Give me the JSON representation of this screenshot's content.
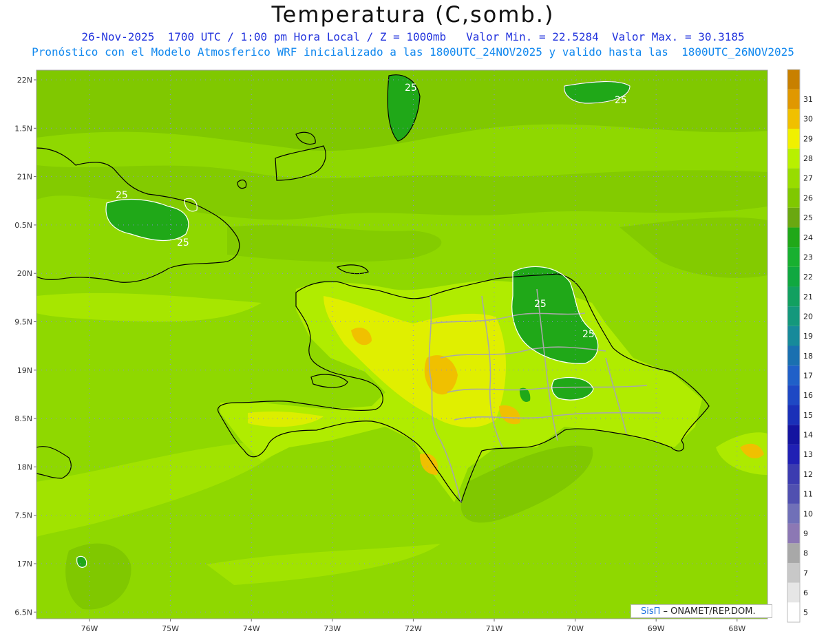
{
  "header": {
    "title": "Temperatura (C,somb.)",
    "subtitle_1": "26-Nov-2025  1700 UTC / 1:00 pm Hora Local / Z = 1000mb   Valor Min. = 22.5284  Valor Max. = 30.3185",
    "subtitle_2": "Pronóstico con el Modelo Atmosferico WRF inicializado a las 1800UTC_24NOV2025 y valido hasta las  1800UTC_26NOV2025"
  },
  "map": {
    "lat_ticks": [
      {
        "value": 22,
        "label": "22N"
      },
      {
        "value": 21.5,
        "label": "1.5N"
      },
      {
        "value": 21,
        "label": "21N"
      },
      {
        "value": 20.5,
        "label": "0.5N"
      },
      {
        "value": 20,
        "label": "20N"
      },
      {
        "value": 19.5,
        "label": "9.5N"
      },
      {
        "value": 19,
        "label": "19N"
      },
      {
        "value": 18.5,
        "label": "8.5N"
      },
      {
        "value": 18,
        "label": "18N"
      },
      {
        "value": 17.5,
        "label": "7.5N"
      },
      {
        "value": 17,
        "label": "17N"
      },
      {
        "value": 16.5,
        "label": "6.5N"
      }
    ],
    "lon_ticks": [
      {
        "value": -76,
        "label": "76W"
      },
      {
        "value": -75,
        "label": "75W"
      },
      {
        "value": -74,
        "label": "74W"
      },
      {
        "value": -73,
        "label": "73W"
      },
      {
        "value": -72,
        "label": "72W"
      },
      {
        "value": -71,
        "label": "71W"
      },
      {
        "value": -70,
        "label": "70W"
      },
      {
        "value": -69,
        "label": "69W"
      },
      {
        "value": -68,
        "label": "68W"
      }
    ],
    "contour_labels": [
      "25",
      "25",
      "25",
      "25",
      "25",
      "25"
    ],
    "background_color": "#8fd800"
  },
  "colorbar": {
    "levels": [
      {
        "label": "5",
        "color": "#ffffff"
      },
      {
        "label": "6",
        "color": "#e6e6e6"
      },
      {
        "label": "7",
        "color": "#c8c8c8"
      },
      {
        "label": "8",
        "color": "#a8a8a8"
      },
      {
        "label": "9",
        "color": "#8c78b4"
      },
      {
        "label": "10",
        "color": "#7070b8"
      },
      {
        "label": "11",
        "color": "#5050b0"
      },
      {
        "label": "12",
        "color": "#3c3cb0"
      },
      {
        "label": "13",
        "color": "#2020b4"
      },
      {
        "label": "14",
        "color": "#1414a0"
      },
      {
        "label": "15",
        "color": "#1a30b8"
      },
      {
        "label": "16",
        "color": "#1e48c4"
      },
      {
        "label": "17",
        "color": "#2060c8"
      },
      {
        "label": "18",
        "color": "#1a70b0"
      },
      {
        "label": "19",
        "color": "#178a9a"
      },
      {
        "label": "20",
        "color": "#14987c"
      },
      {
        "label": "21",
        "color": "#12a060"
      },
      {
        "label": "22",
        "color": "#10a840"
      },
      {
        "label": "23",
        "color": "#18b030"
      },
      {
        "label": "24",
        "color": "#20a818"
      },
      {
        "label": "25",
        "color": "#6aa810"
      },
      {
        "label": "26",
        "color": "#80c800"
      },
      {
        "label": "27",
        "color": "#98dc00"
      },
      {
        "label": "28",
        "color": "#b8f000"
      },
      {
        "label": "29",
        "color": "#f0f000"
      },
      {
        "label": "30",
        "color": "#f0c000"
      },
      {
        "label": "31",
        "color": "#e09800"
      },
      {
        "label": "",
        "color": "#c88000"
      }
    ]
  },
  "credit": {
    "brand": "SisΠ",
    "text": " – ONAMET/REP.DOM."
  }
}
